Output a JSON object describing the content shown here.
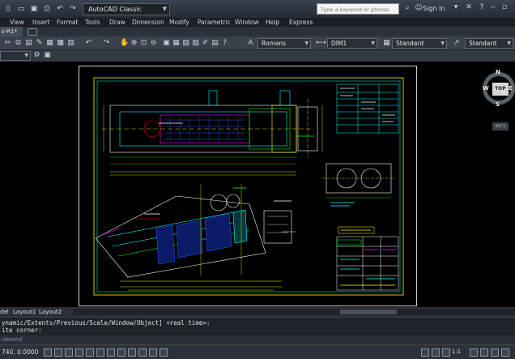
{
  "titlebar": {
    "workspace": "AutoCAD Classic",
    "search_placeholder": "Type a keyword or phrase",
    "sign_in": "Sign In"
  },
  "menu": [
    "View",
    "Insert",
    "Format",
    "Tools",
    "Draw",
    "Dimension",
    "Modify",
    "Parametric",
    "Window",
    "Help",
    "Express"
  ],
  "tab": {
    "label": "s-R1*"
  },
  "toolbar": {
    "text_style": "Romans",
    "dim_style": "DIM1",
    "table_style": "Standard",
    "mleader_style": "Standard"
  },
  "layout_tabs": [
    "del",
    "Layout1",
    "Layout2"
  ],
  "command": {
    "history": [
      "ynamic/Extents/Previous/Scale/Window/Object] <real time>:",
      "ite corner:"
    ],
    "prompt": "ommand"
  },
  "status": {
    "coords": "740, 0.0000",
    "scale": "1:1"
  },
  "viewcube": {
    "top": "TOP",
    "north": "N",
    "south": "S",
    "east": "E",
    "west": "W",
    "wcs": "WCS"
  },
  "colors": {
    "drawing_bg": "#000000",
    "cyan": "#00ffff",
    "yellow": "#ffff00",
    "magenta": "#ff00ff",
    "blue": "#3050ff",
    "green": "#00ff00",
    "white": "#ffffff"
  }
}
